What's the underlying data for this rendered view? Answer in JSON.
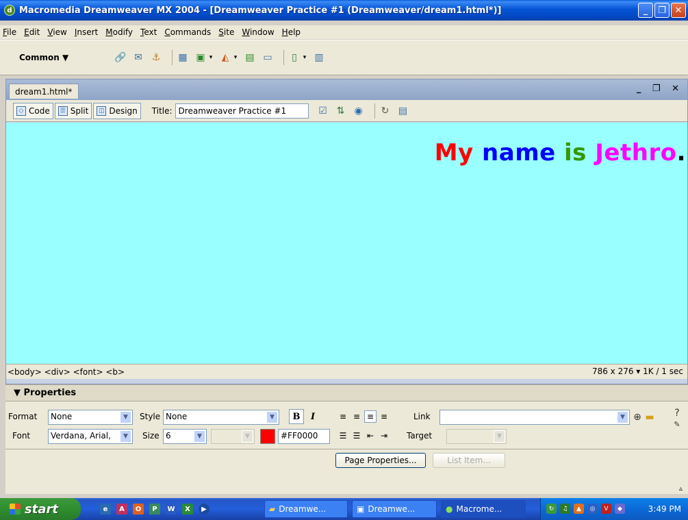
{
  "window": {
    "title": "Macromedia Dreamweaver MX 2004 - [Dreamweaver Practice #1 (Dreamweaver/dream1.html*)]",
    "min_icon": "minimize-icon",
    "max_icon": "maximize-icon",
    "close_icon": "close-icon"
  },
  "menu": [
    "File",
    "Edit",
    "View",
    "Insert",
    "Modify",
    "Text",
    "Commands",
    "Site",
    "Window",
    "Help"
  ],
  "insert_bar": {
    "category": "Common ▼"
  },
  "document": {
    "tab_label": "dream1.html*",
    "view_buttons": [
      "Code",
      "Split",
      "Design"
    ],
    "title_label": "Title:",
    "title_value": "Dreamweaver Practice #1",
    "content_words": [
      {
        "text": "My",
        "color": "#ff0000"
      },
      {
        "text": "name",
        "color": "#0000ff"
      },
      {
        "text": "is",
        "color": "#339900"
      },
      {
        "text": "Jethro",
        "color": "#ff00ff"
      },
      {
        "text": ".",
        "color": "#000000"
      }
    ],
    "canvas_color": "#99ffff",
    "tag_selector": "<body> <div> <font> <b>",
    "status_right": "786 x 276 ▾ 1K / 1 sec"
  },
  "properties": {
    "header": "▼ Properties",
    "format_label": "Format",
    "format_value": "None",
    "style_label": "Style",
    "style_value": "None",
    "font_label": "Font",
    "font_value": "Verdana, Arial,",
    "size_label": "Size",
    "size_value": "6",
    "color_value": "#FF0000",
    "bold_label": "B",
    "italic_label": "I",
    "link_label": "Link",
    "target_label": "Target",
    "page_properties_button": "Page Properties...",
    "list_item_button": "List Item..."
  },
  "taskbar": {
    "start_label": "start",
    "items": [
      "Dreamwe...",
      "Dreamwe...",
      "Macrome..."
    ],
    "clock": "3:49 PM"
  }
}
